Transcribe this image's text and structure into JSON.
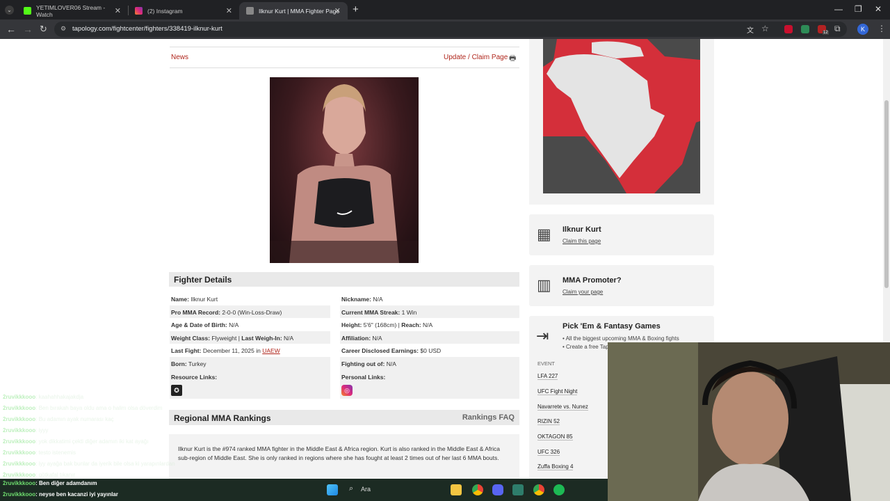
{
  "browser": {
    "tabs": [
      {
        "label": "YETIMLOVER06 Stream - Watch",
        "color": "#53fc18"
      },
      {
        "label": "(2) Instagram",
        "color": "#e1306c"
      },
      {
        "label": "Ilknur Kurt | MMA Fighter Page",
        "color": "#888888"
      }
    ],
    "new_tab": "+",
    "url": "tapology.com/fightcenter/fighters/338419-ilknur-kurt",
    "profile": "K",
    "badge_count": "12"
  },
  "page": {
    "news_link": "News",
    "update_link": "Update / Claim Page",
    "fighter_details_title": "Fighter Details",
    "details_left": [
      {
        "label": "Name:",
        "value": "Ilknur Kurt"
      },
      {
        "label": "Pro MMA Record:",
        "value": "2-0-0 (Win-Loss-Draw)"
      },
      {
        "label": "Age & Date of Birth:",
        "value": "N/A"
      },
      {
        "label": "Weight Class:",
        "value": "Flyweight",
        "label2": "Last Weigh-In:",
        "value2": "N/A"
      },
      {
        "label": "Last Fight:",
        "value": "December 11, 2025 in",
        "link": "UAEW"
      },
      {
        "label": "Born:",
        "value": "Turkey"
      },
      {
        "label": "Resource Links:",
        "value": ""
      }
    ],
    "details_right": [
      {
        "label": "Nickname:",
        "value": "N/A"
      },
      {
        "label": "Current MMA Streak:",
        "value": "1 Win"
      },
      {
        "label": "Height:",
        "value": "5'6\" (168cm)",
        "label2": "Reach:",
        "value2": "N/A"
      },
      {
        "label": "Affiliation:",
        "value": "N/A"
      },
      {
        "label": "Career Disclosed Earnings:",
        "value": "$0 USD"
      },
      {
        "label": "Fighting out of:",
        "value": "N/A"
      },
      {
        "label": "Personal Links:",
        "value": ""
      }
    ],
    "rankings_title": "Regional MMA Rankings",
    "rankings_faq": "Rankings FAQ",
    "rankings_text": "Ilknur Kurt is the #974 ranked MMA fighter in the Middle East & Africa region. Kurt is also ranked in the Middle East & Africa sub-region of Middle East. She is only ranked in regions where she has fought at least 2 times out of her last 6 MMA bouts."
  },
  "sidebar": {
    "claim_card": {
      "title": "Ilknur Kurt",
      "sub": "Claim this page"
    },
    "promoter_card": {
      "title": "MMA Promoter?",
      "sub": "Claim your page"
    },
    "pickem_card": {
      "title": "Pick 'Em & Fantasy Games",
      "bullets": [
        "• All the biggest upcoming MMA & Boxing fights",
        "• Create a free Tap"
      ],
      "event_header": "EVENT",
      "events": [
        "LFA 227",
        "UFC Fight Night",
        "Navarrete vs. Nunez",
        "RIZIN 52",
        "OKTAGON 85",
        "UFC 326",
        "Zuffa Boxing 4"
      ]
    }
  },
  "chat": [
    {
      "user": "2ruvikkkooo",
      "msg": ": kaahahhakajakdja",
      "faded": true
    },
    {
      "user": "2ruvikkkooo",
      "msg": ": Ben bırakah baya oldu ama o halim olsa döverdim",
      "faded": true
    },
    {
      "user": "2ruvikkkooo",
      "msg": ": Bu adamın ayak numarası kaç",
      "faded": true
    },
    {
      "user": "2ruvikkkooo",
      "msg": ": iyyy",
      "faded": true
    },
    {
      "user": "2ruvikkkooo",
      "msg": ": yok dikkatimi çekti diğer adamın iki kat ayağı",
      "faded": true
    },
    {
      "user": "2ruvikkkooo",
      "msg": ": testo istenemis",
      "faded": true
    },
    {
      "user": "2ruvikkkooo",
      "msg": ": iyy ayağa bak bunlar da iyerik bile olsa ki yarapınlardan",
      "faded": true
    },
    {
      "user": "2ruvikkkooo",
      "msg": ": götkafal tıkanır",
      "faded": true
    },
    {
      "user": "2ruvikkkooo",
      "msg": ": Ben diğer adamdanım",
      "faded": false
    },
    {
      "user": "2ruvikkkooo",
      "msg": ": neyse ben kacanzi iyi yayınlar",
      "faded": false
    }
  ],
  "taskbar": {
    "search_placeholder": "Ara"
  }
}
